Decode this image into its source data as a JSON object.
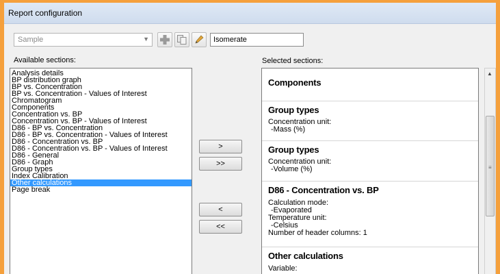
{
  "window": {
    "title": "Report configuration"
  },
  "toolbar": {
    "template_select": {
      "value": "Sample"
    },
    "add_icon": "plus-icon",
    "copy_icon": "copy-icon",
    "edit_icon": "pencil-icon",
    "name_input": {
      "value": "Isomerate"
    }
  },
  "available": {
    "label": "Available sections:",
    "items": [
      "Analysis details",
      "BP distribution graph",
      "BP vs. Concentration",
      "BP vs. Concentration - Values of Interest",
      "Chromatogram",
      "Components",
      "Concentration vs. BP",
      "Concentration vs. BP - Values of Interest",
      "D86 - BP vs. Concentration",
      "D86 - BP vs. Concentration - Values of Interest",
      "D86 - Concentration vs. BP",
      "D86 - Concentration vs. BP - Values of Interest",
      "D86 - General",
      "D86 - Graph",
      "Group types",
      "Index Calibration",
      "Other calculations",
      "Page break"
    ],
    "selected_index": 16
  },
  "buttons": {
    "add_one": ">",
    "add_all": ">>",
    "remove_one": "<",
    "remove_all": "<<"
  },
  "selected": {
    "label": "Selected sections:",
    "cards": [
      {
        "title": "Components"
      },
      {
        "title": "Group types",
        "line1": "Concentration unit:",
        "line2": "-Mass (%)"
      },
      {
        "title": "Group types",
        "line1": "Concentration unit:",
        "line2": "-Volume (%)"
      },
      {
        "title": "D86 - Concentration vs. BP",
        "line1": "Calculation mode:",
        "line2": "-Evaporated",
        "line3": "Temperature unit:",
        "line4": "-Celsius",
        "line5": "Number of header columns: 1"
      },
      {
        "title": "Other calculations",
        "line1": "Variable:"
      }
    ]
  },
  "colors": {
    "frame": "#f5a03c",
    "selection": "#3399ff"
  }
}
